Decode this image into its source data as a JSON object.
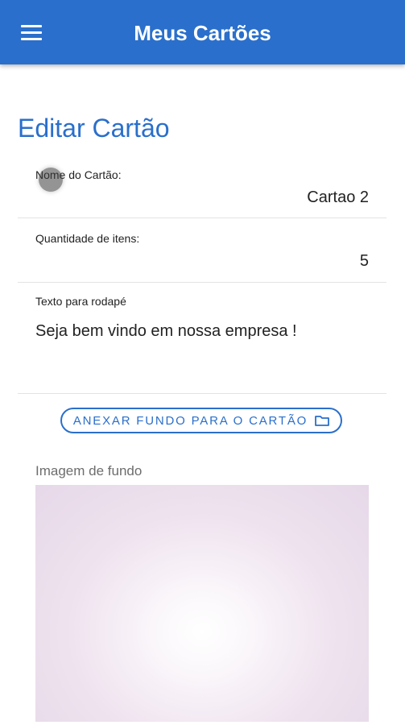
{
  "app_bar": {
    "title": "Meus Cartões",
    "menu_icon": "menu-icon"
  },
  "form": {
    "title": "Editar Cartão",
    "name": {
      "label": "Nome do Cartão:",
      "value": "Cartao 2"
    },
    "quantity": {
      "label": "Quantidade de itens:",
      "value": "5"
    },
    "footer_text": {
      "label": "Texto para rodapé",
      "value": "Seja bem vindo em nossa empresa !"
    }
  },
  "attach_button": {
    "label": "ANEXAR FUNDO PARA O CARTÃO",
    "icon": "folder-icon"
  },
  "background_image": {
    "label": "Imagem de fundo"
  },
  "colors": {
    "primary": "#2a6fcb",
    "image_tint": "#e6d8e8"
  }
}
